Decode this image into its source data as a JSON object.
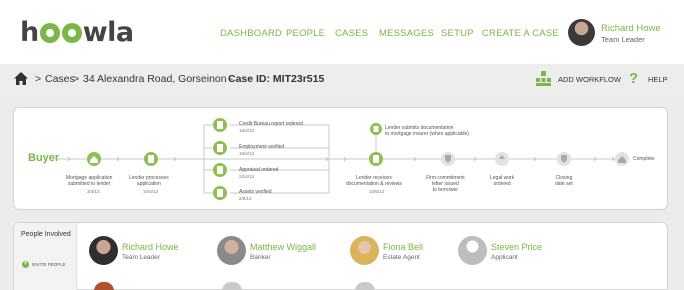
{
  "app": {
    "logo_text": "hoowla"
  },
  "nav": {
    "items": [
      "DASHBOARD",
      "PEOPLE",
      "CASES",
      "MESSAGES",
      "SETUP",
      "CREATE A CASE"
    ]
  },
  "user": {
    "name": "Richard Howe",
    "role": "Team Leader"
  },
  "breadcrumb": {
    "separator": ">",
    "cases": "Cases",
    "address": "34 Alexandra Road, Gorseinon -",
    "case_id": "Case ID: MIT23r515"
  },
  "actions": {
    "add_workflow": "ADD WORKFLOW",
    "help": "HELP",
    "help_glyph": "?"
  },
  "workflow": {
    "party": "Buyer",
    "steps": [
      {
        "label": "Mortgage application\nsubmitted to lender",
        "date": "3/4/13",
        "state": "done"
      },
      {
        "label": "Lender processes\napplication",
        "date": "10/4/13",
        "state": "done"
      },
      {
        "label": "Lender receives\ndocumentation & reviews",
        "date": "10/5/13",
        "state": "done"
      },
      {
        "label": "Firm commitment\nletter issued\nto borrower",
        "date": "",
        "state": "pending"
      },
      {
        "label": "Legal work\nordered",
        "date": "",
        "state": "pending"
      },
      {
        "label": "Closing\ndate set",
        "date": "",
        "state": "pending"
      },
      {
        "label": "Complete",
        "date": "",
        "state": "pending"
      }
    ],
    "parallel_steps": [
      {
        "label": "Credit Bureau report ordered",
        "date": "18/4/13"
      },
      {
        "label": "Employment verified",
        "date": "18/4/13"
      },
      {
        "label": "Appraisal ordered",
        "date": "22/4/13"
      },
      {
        "label": "Assets verified",
        "date": "2/5/13"
      }
    ],
    "side_step": {
      "label": "Lender submits documentation\nto mortgage insurer (when applicable)"
    }
  },
  "people": {
    "title": "People Involved",
    "invite_label": "INVITE PEOPLE",
    "invite_glyph": "+",
    "list": [
      {
        "name": "Richard Howe",
        "role": "Team Leader"
      },
      {
        "name": "Matthew Wiggall",
        "role": "Banker"
      },
      {
        "name": "Fiona Bell",
        "role": "Estate Agent"
      },
      {
        "name": "Steven Price",
        "role": "Applicant"
      }
    ]
  },
  "colors": {
    "accent": "#7ab648",
    "done_icon": "#8cc152",
    "pending_icon": "#a9a9a9",
    "background": "#ececec"
  },
  "icons": [
    "home-icon",
    "add-workflow-icon",
    "help-icon",
    "house-step-icon",
    "document-step-icon",
    "shield-step-icon",
    "invite-plus-icon"
  ]
}
